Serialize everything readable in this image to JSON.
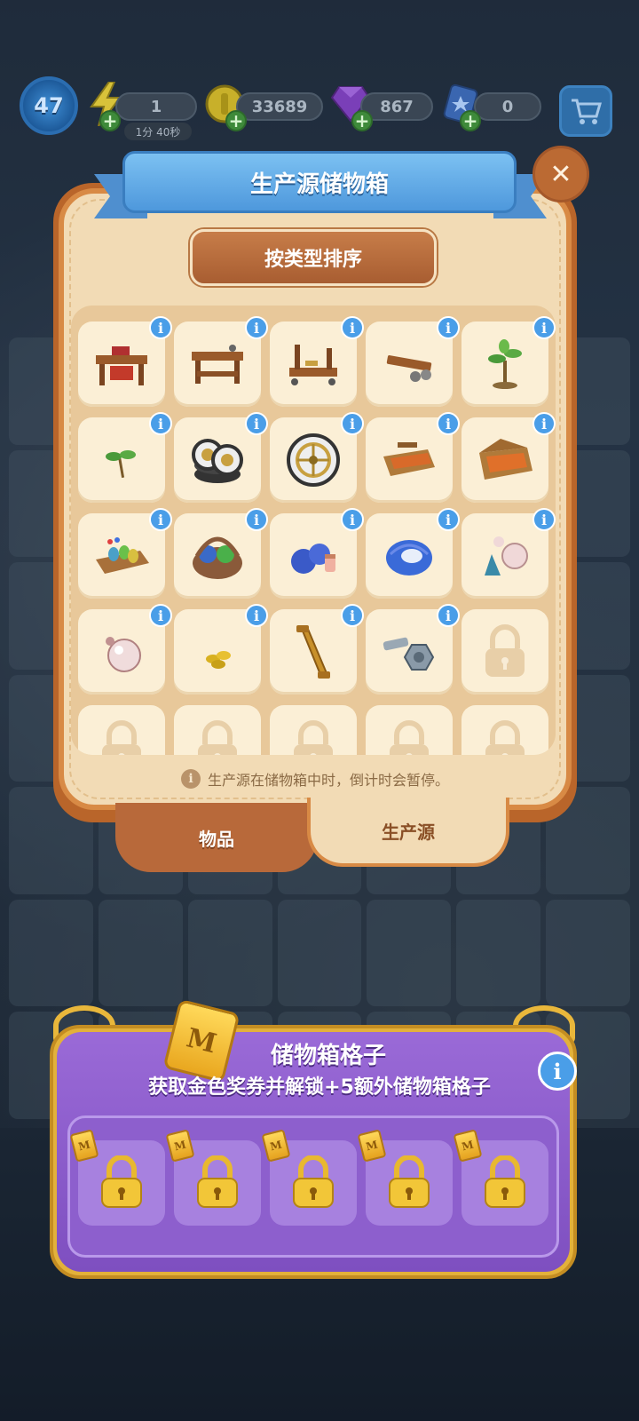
{
  "hud": {
    "level": "47",
    "energy": "1",
    "energy_timer": "1分 40秒",
    "coins": "33689",
    "gems": "867",
    "cards": "0"
  },
  "panel": {
    "title": "生产源储物箱",
    "sort_label": "按类型排序",
    "info_note": "生产源在储物箱中时，倒计时会暂停。",
    "items": [
      {
        "icon": "workbench-red-icon",
        "locked": false
      },
      {
        "icon": "workbench-icon",
        "locked": false
      },
      {
        "icon": "workbench-frame-icon",
        "locked": false
      },
      {
        "icon": "wheel-cart-icon",
        "locked": false
      },
      {
        "icon": "sapling-icon",
        "locked": false
      },
      {
        "icon": "sprout-icon",
        "locked": false
      },
      {
        "icon": "wheel-stack-icon",
        "locked": false
      },
      {
        "icon": "wheel-icon",
        "locked": false
      },
      {
        "icon": "toolbox-icon",
        "locked": false
      },
      {
        "icon": "toolbox-open-icon",
        "locked": false
      },
      {
        "icon": "sewing-tray-icon",
        "locked": false
      },
      {
        "icon": "yarn-basket-icon",
        "locked": false
      },
      {
        "icon": "yarn-balls-icon",
        "locked": false
      },
      {
        "icon": "yarn-ball-icon",
        "locked": false
      },
      {
        "icon": "pearl-tassel-icon",
        "locked": false
      },
      {
        "icon": "pearl-icon",
        "locked": false
      },
      {
        "icon": "seeds-icon",
        "locked": false
      },
      {
        "icon": "handle-icon",
        "locked": false
      },
      {
        "icon": "nut-bolt-icon",
        "locked": false
      },
      {
        "icon": "lock-icon",
        "locked": true
      },
      {
        "icon": "lock-icon",
        "locked": true
      },
      {
        "icon": "lock-icon",
        "locked": true
      },
      {
        "icon": "lock-icon",
        "locked": true
      },
      {
        "icon": "lock-icon",
        "locked": true
      },
      {
        "icon": "lock-icon",
        "locked": true
      }
    ]
  },
  "tabs": {
    "items": "物品",
    "producers": "生产源"
  },
  "promo": {
    "title": "储物箱格子",
    "subtitle": "获取金色奖券并解锁+5额外储物箱格子",
    "ticket_letter": "M",
    "slot_count": 5
  },
  "colors": {
    "panel_bg": "#f2dbb5",
    "panel_border": "#d88a45",
    "ribbon_blue": "#4e98dc",
    "sort_button": "#a85d31",
    "info_blue": "#4a9ee8",
    "promo_purple": "#8d5fcd",
    "gold": "#e9b73b"
  }
}
